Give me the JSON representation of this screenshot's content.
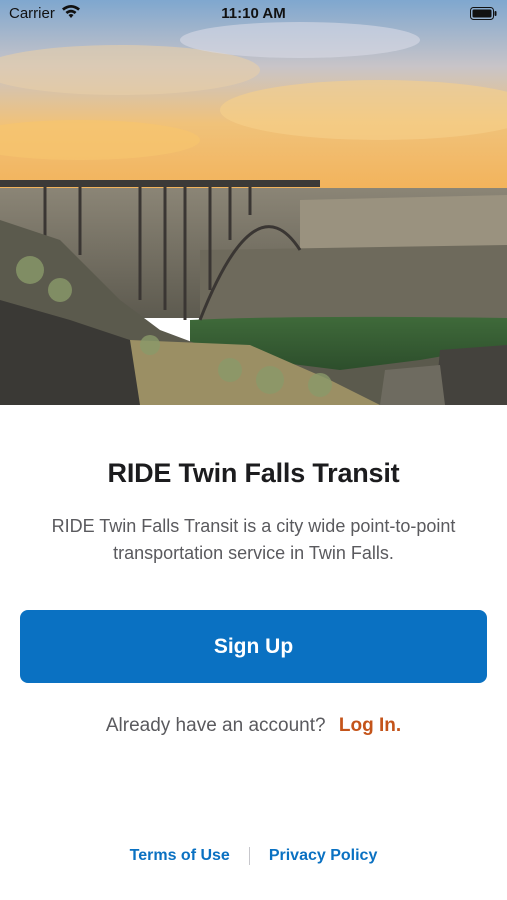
{
  "status_bar": {
    "carrier": "Carrier",
    "time": "11:10 AM",
    "wifi_icon": "wifi-icon",
    "battery_icon": "battery-icon"
  },
  "hero": {
    "image": "canyon-bridge-sunset-photo"
  },
  "main": {
    "title": "RIDE Twin Falls Transit",
    "description": "RIDE Twin Falls Transit is a city wide point-to-point transportation service in Twin Falls.",
    "signup_label": "Sign Up",
    "login_prompt": "Already have an account?",
    "login_link": "Log In."
  },
  "footer": {
    "terms": "Terms of Use",
    "privacy": "Privacy Policy"
  },
  "colors": {
    "primary": "#0a71c2",
    "login_accent": "#c4541a",
    "footer_link": "#0a71c2",
    "body_text": "#5a5a5e",
    "title_text": "#1c1c1e"
  }
}
